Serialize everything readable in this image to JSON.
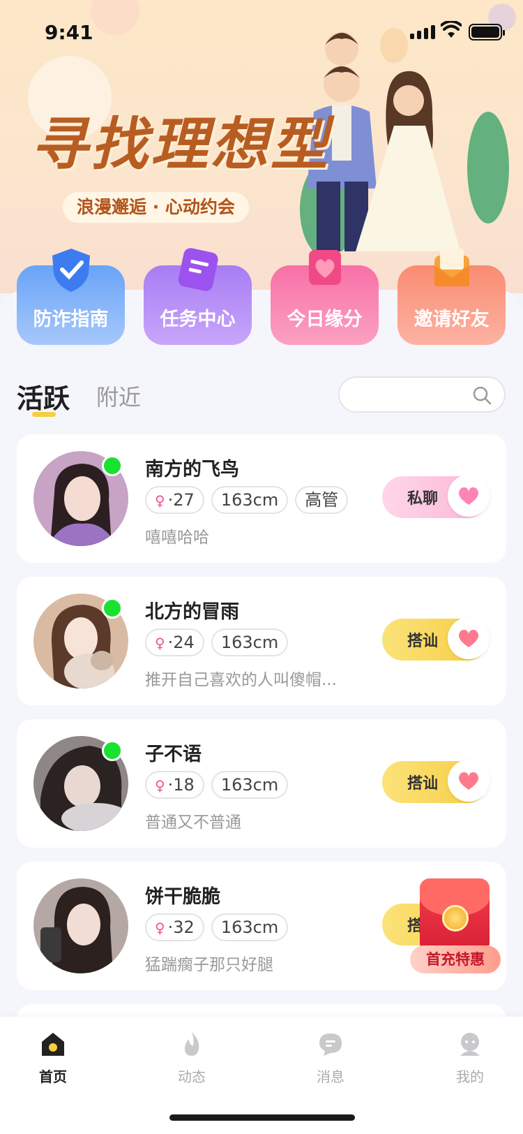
{
  "status_bar": {
    "time": "9:41"
  },
  "banner": {
    "title": "寻找理想型",
    "subtitle": "浪漫邂逅 · 心动约会"
  },
  "features": [
    {
      "label": "防诈指南",
      "icon": "shield-check-icon",
      "color": "#6aa3f8"
    },
    {
      "label": "任务中心",
      "icon": "task-list-icon",
      "color": "#a77df4"
    },
    {
      "label": "今日缘分",
      "icon": "heart-tag-icon",
      "color": "#f870a7"
    },
    {
      "label": "邀请好友",
      "icon": "invite-envelope-icon",
      "color": "#f98c72"
    }
  ],
  "tabs": {
    "active": "活跃",
    "inactive": "附近"
  },
  "search": {
    "placeholder": ""
  },
  "users": [
    {
      "name": "南方的飞鸟",
      "gender": "♀",
      "age": "·27",
      "height": "163cm",
      "job": "高管",
      "bio": "嘻嘻哈哈",
      "online": true,
      "cta": "私聊",
      "cta_style": "pink"
    },
    {
      "name": "北方的冒雨",
      "gender": "♀",
      "age": "·24",
      "height": "163cm",
      "bio": "推开自己喜欢的人叫傻帽...",
      "online": true,
      "cta": "搭讪",
      "cta_style": "yellow"
    },
    {
      "name": "子不语",
      "gender": "♀",
      "age": "·18",
      "height": "163cm",
      "bio": "普通又不普通",
      "online": true,
      "cta": "搭讪",
      "cta_style": "yellow"
    },
    {
      "name": "饼干脆脆",
      "gender": "♀",
      "age": "·32",
      "height": "163cm",
      "bio": "猛踹瘸子那只好腿",
      "online": false,
      "cta": "搭讪",
      "cta_style": "yellow"
    }
  ],
  "promo": {
    "label": "首充特惠"
  },
  "tabbar": [
    {
      "label": "首页",
      "icon": "home-icon",
      "active": true
    },
    {
      "label": "动态",
      "icon": "flame-icon",
      "active": false
    },
    {
      "label": "消息",
      "icon": "chat-bubble-icon",
      "active": false
    },
    {
      "label": "我的",
      "icon": "profile-icon",
      "active": false
    }
  ],
  "colors": {
    "accent_yellow": "#f6cf3b",
    "online_green": "#18e12f",
    "pink": "#f1529a"
  }
}
